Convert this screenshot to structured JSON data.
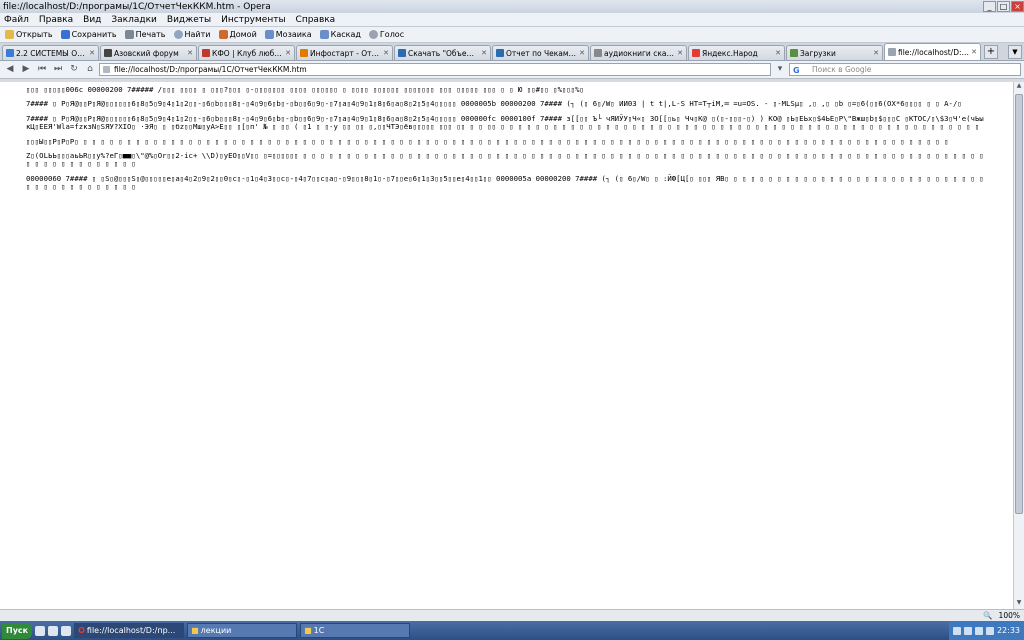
{
  "window": {
    "title": "file://localhost/D:/програмы/1С/ОтчетЧекККМ.htm - Opera"
  },
  "menu": [
    "Файл",
    "Правка",
    "Вид",
    "Закладки",
    "Виджеты",
    "Инструменты",
    "Справка"
  ],
  "toolbar": [
    "Открыть",
    "Сохранить",
    "Печать",
    "Найти",
    "Домой",
    "Мозаика",
    "Каскад",
    "Голос"
  ],
  "tabs": [
    {
      "label": "2.2 СИСТЕМЫ ОПЛ...",
      "color": "#3a7bd5"
    },
    {
      "label": "Азовский форум",
      "color": "#444444"
    },
    {
      "label": "КФО | Клуб любит...",
      "color": "#c0392b"
    },
    {
      "label": "Инфостарт - Ответ...",
      "color": "#e07b00"
    },
    {
      "label": "Скачать \"Объедин...",
      "color": "#2b6cb0"
    },
    {
      "label": "Отчет по Чекам ККМ",
      "color": "#2b6cb0"
    },
    {
      "label": "аудиокниги скачат...",
      "color": "#888888"
    },
    {
      "label": "Яндекс.Народ",
      "color": "#e53935"
    },
    {
      "label": "Загрузки",
      "color": "#5a8f3c"
    },
    {
      "label": "file://localhost/D:/п...",
      "color": "#9aa4b1",
      "active": true
    }
  ],
  "address": {
    "url": "file://localhost/D:/програмы/1С/ОтчетЧекККМ.htm",
    "search_engine": "G",
    "search_placeholder": "Поиск в Google"
  },
  "content_lines": [
    "  ▯▯▯ ▯▯▯▯▯006с 00000200 7##### /▯▯▯ ▯▯▯▯ ▯ ▯▯▯?▯▯▯ ▯-▯▯▯▯▯▯▯ ▯▯▯▯ ▯▯▯▯▯▯ ▯ ▯▯▯▯ ▯▯▯▯▯▯ ▯▯▯▯▯▯▯ ▯▯▯ ▯▯▯▯▯ ▯▯▯ ▯ ▯ Ю ▯▯#▯▯ ▯%▯▯▯%▯",
    "7#### ▯ Р▯Я@▯▯Р▯Я@▯▯▯▯▯▯6▯8▯5▯9▯4▯1▯2▯▯-▯6▯b▯▯▯8▯-▯4▯9▯6▯b▯-▯b▯▯6▯9▯-▯7▯а▯4▯9▯1▯8▯6▯а▯8▯2▯5▯4▯▯▯▯▯ 0000005b 00000200 7#### (┐ (▯ 6▯/W▯ ИИ03 | t t|,L-S HТ=Т┬іМ,═ =u=OS. - ▯-МLSµ▯ ,▯ ,▯ ▯b ▯=▯6(▯▯6(ОХ*6▯▯▯▯ ▯ ▯ А-/▯",
    "7#### ▯ Р▯Я@▯▯Р▯Я@▯▯▯▯▯▯6▯8▯5▯9▯4▯1▯2▯▯-▯6▯b▯▯▯8▯-▯4▯9▯6▯b▯-▯b▯▯6▯9▯-▯7▯а▯4▯9▯1▯8▯6▯а▯8▯2▯5▯4▯▯▯▯▯ 000000fc 0000100f 7#### з[[▯▯ Ъ└ чЯИЎУ▯Ч«▯ ЗО[[▯ь▯ Чч▯К@ ▯(▯-▯▯▯-▯) ) КО@ ▯Ь▯ЕЬх▯$4ЬЕ▯Р\\\"Вжш▯b▯$▯▯▯С ▯КТОС/▯\\$3▯Ч'е(чЬыкЦ▯ЕЕЯ'Wla=fzкзN▯SЯУ?ХІО▯ ·ЭЯ▯ ▯ ▯бz▯▯Мш▯уА>Е▯▯ ▯[▯п' № ▯ ▯▯ ( ▯1 ▯ ▯-у ▯▯ ▯▯ ▯,▯▯ЧТЭ▯ёв▯▯▯▯▯ ▯▯▯ ▯▯ ▯ ▯ ▯▯ ▯ ▯ ▯ ▯ ▯ ▯ ▯ ▯ ▯ ▯ ▯ ▯ ▯ ▯ ▯ ▯ ▯ ▯ ▯ ▯ ▯ ▯ ▯ ▯ ▯ ▯ ▯ ▯ ▯ ▯ ▯ ▯ ▯ ▯ ▯ ▯ ▯ ▯ ▯ ▯ ▯ ▯ ▯ ▯ ▯ ▯ ▯ ▯ ▯ ▯ ▯ ▯ ▯ ▯ ▯",
    "▯▯▯Ы▯▯Р▯Р▯Р▯ ▯ ▯ ▯ ▯ ▯ ▯ ▯ ▯ ▯ ▯ ▯ ▯ ▯ ▯ ▯ ▯ ▯ ▯ ▯ ▯ ▯ ▯ ▯ ▯ ▯ ▯ ▯ ▯ ▯ ▯ ▯ ▯ ▯ ▯ ▯ ▯ ▯ ▯ ▯ ▯ ▯ ▯ ▯ ▯ ▯ ▯ ▯ ▯ ▯ ▯ ▯ ▯ ▯ ▯ ▯ ▯ ▯ ▯ ▯ ▯ ▯ ▯ ▯ ▯ ▯ ▯ ▯ ▯ ▯ ▯ ▯ ▯ ▯ ▯ ▯ ▯ ▯ ▯ ▯ ▯ ▯ ▯ ▯ ▯ ▯ ▯ ▯ ▯ ▯ ▯ ▯ ▯ ▯ ▯ ▯ ▯ ▯ ▯ ▯",
    "Z▯(ОLЬЬ▯▯▯аьЬR▯▯y%?еГ▯■■▯\\\"@%▯Or▯▯2-іс+ \\\\D)▯уЕО▯▯V▯▯ ▯=▯▯▯▯▯▯ ▯ ▯ ▯ ▯ ▯ ▯ ▯ ▯ ▯ ▯ ▯ ▯ ▯ ▯ ▯ ▯ ▯ ▯ ▯ ▯ ▯ ▯ ▯ ▯ ▯ ▯ ▯ ▯ ▯ ▯ ▯ ▯ ▯ ▯ ▯ ▯ ▯ ▯ ▯ ▯ ▯ ▯ ▯ ▯ ▯ ▯ ▯ ▯ ▯ ▯ ▯ ▯ ▯ ▯ ▯ ▯ ▯ ▯ ▯ ▯ ▯ ▯ ▯ ▯ ▯ ▯ ▯ ▯ ▯ ▯ ▯ ▯ ▯ ▯ ▯ ▯ ▯ ▯ ▯ ▯ ▯ ▯ ▯ ▯ ▯ ▯ ▯ ▯ ▯ ▯ ▯",
    "00000060 7#### ▯ ▯S▯@▯▯▯S▯@▯▯▯▯▯е▯а▯4▯2▯9▯2▯▯0▯с▯-▯1▯4▯3▯▯с▯-▯4▯7▯▯с▯а▯-▯9▯▯▯8▯1▯-▯7▯▯е▯6▯1▯3▯▯5▯▯е▯4▯▯1▯▯ 0000005а 00000200 7#### (┐ (▯ 6▯/W▯ ▯ :ЙФ[Ц[▯ ▯▯▯ ЯВ▯ ▯ ▯ ▯ ▯ ▯ ▯ ▯ ▯ ▯ ▯ ▯ ▯ ▯ ▯ ▯ ▯ ▯ ▯ ▯ ▯ ▯ ▯ ▯ ▯ ▯ ▯ ▯ ▯ ▯ ▯ ▯ ▯ ▯ ▯ ▯ ▯ ▯ ▯ ▯ ▯ ▯ ▯"
  ],
  "statusbar": {
    "zoom": "100%"
  },
  "taskbar": {
    "start": "Пуск",
    "tasks": [
      "file://localhost/D:/пр...",
      "лекции",
      "1С"
    ],
    "clock": "22:33"
  }
}
